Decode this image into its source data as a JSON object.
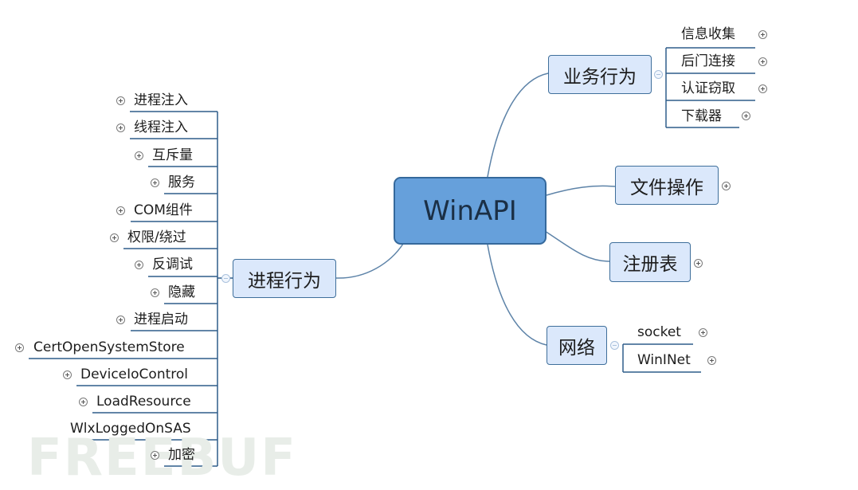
{
  "central": "WinAPI",
  "branches": {
    "business": {
      "label": "业务行为",
      "children": [
        "信息收集",
        "后门连接",
        "认证窃取",
        "下载器"
      ]
    },
    "file": {
      "label": "文件操作"
    },
    "registry": {
      "label": "注册表"
    },
    "network": {
      "label": "网络",
      "children": [
        "socket",
        "WinINet"
      ]
    },
    "process": {
      "label": "进程行为",
      "children": [
        "进程注入",
        "线程注入",
        "互斥量",
        "服务",
        "COM组件",
        "权限/绕过",
        "反调试",
        "隐藏",
        "进程启动",
        "CertOpenSystemStore",
        "DeviceIoControl",
        "LoadResource",
        "WlxLoggedOnSAS",
        "加密"
      ]
    }
  },
  "watermark": "FREEBUF",
  "colors": {
    "node_fill": "#dbe8fb",
    "central_fill": "#66a0db",
    "line": "#5d83a8"
  }
}
